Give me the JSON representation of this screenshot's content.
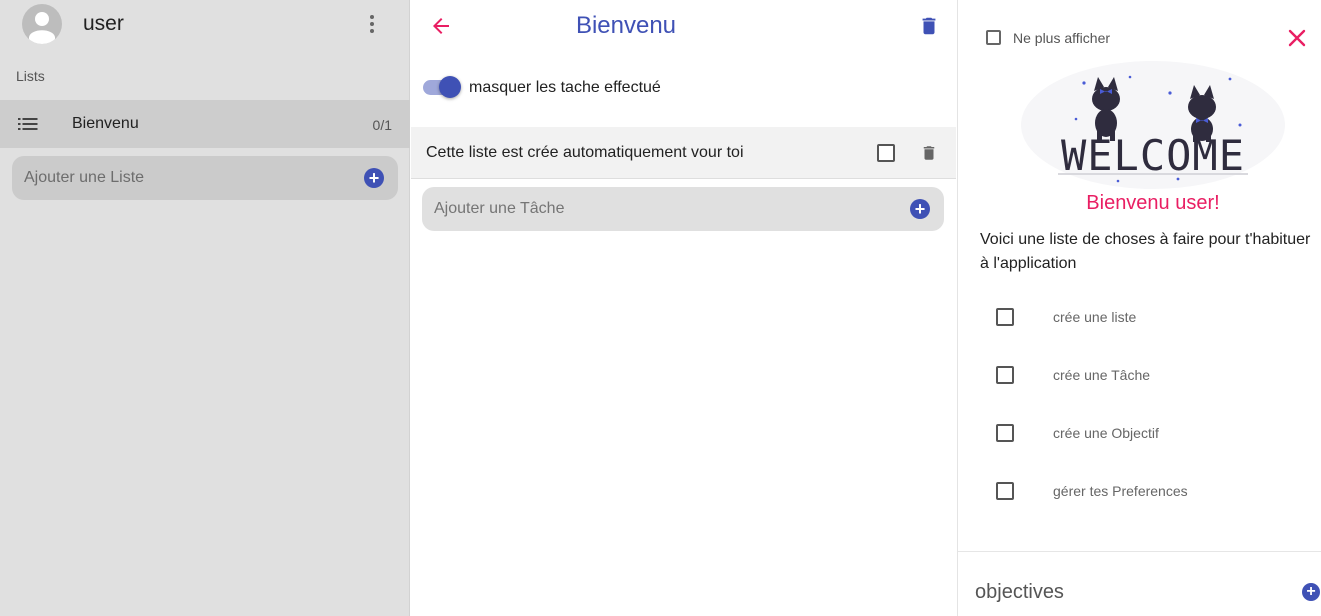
{
  "sidebar": {
    "user_name": "user",
    "lists_label": "Lists",
    "lists": [
      {
        "name": "Bienvenu",
        "count": "0/1"
      }
    ],
    "add_list_placeholder": "Ajouter une Liste",
    "add_icon": "add-circle-icon",
    "more_icon": "more-vert-icon",
    "avatar_icon": "account-circle-icon",
    "list_icon": "list-icon"
  },
  "main": {
    "title": "Bienvenu",
    "back_icon": "arrow-back-icon",
    "delete_icon": "delete-icon",
    "toggle": {
      "label": "masquer les tache effectué",
      "on": true
    },
    "tasks": [
      {
        "text": "Cette liste est crée automatiquement vour toi",
        "done": false
      }
    ],
    "add_task_placeholder": "Ajouter une Tâche"
  },
  "welcome_panel": {
    "dont_show_label": "Ne plus afficher",
    "close_icon": "close-icon",
    "illustration": "welcome-cats-illustration",
    "illustration_text": "WELCOME",
    "greeting": "Bienvenu user!",
    "intro": "Voici une liste de choses à faire pour t'habituer à l'application",
    "todos": [
      {
        "label": "crée une liste",
        "checked": false
      },
      {
        "label": "crée une Tâche",
        "checked": false
      },
      {
        "label": "crée une Objectif",
        "checked": false
      },
      {
        "label": "gérer tes Preferences",
        "checked": false
      }
    ],
    "objectives_label": "objectives"
  },
  "colors": {
    "primary": "#3f51b5",
    "accent": "#e91e63",
    "sidebar_bg": "#e0e0e0",
    "selected_row": "#cdcdcd"
  }
}
